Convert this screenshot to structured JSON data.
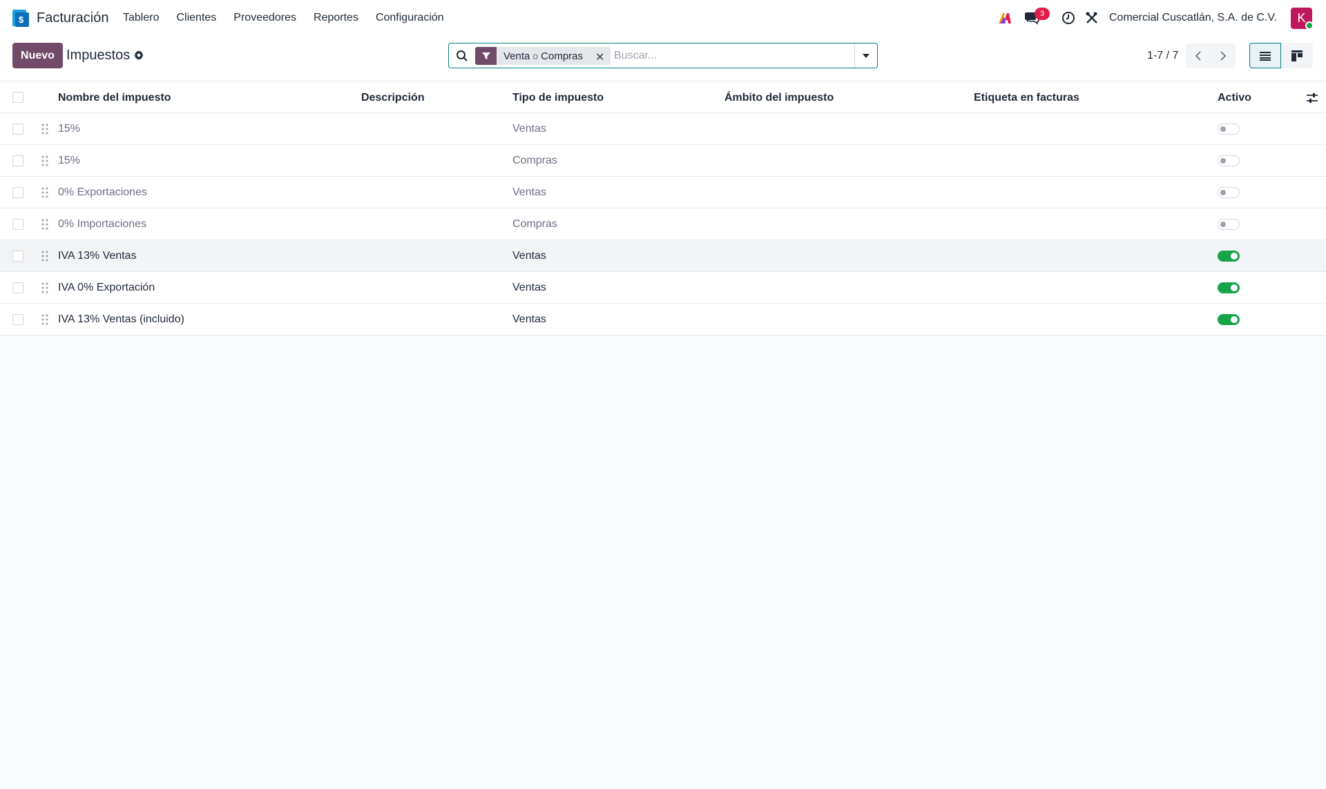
{
  "navbar": {
    "app_name": "Facturación",
    "menu": [
      "Tablero",
      "Clientes",
      "Proveedores",
      "Reportes",
      "Configuración"
    ],
    "messages_count": "3",
    "company": "Comercial Cuscatlán, S.A. de C.V.",
    "avatar_letter": "K"
  },
  "control": {
    "new_label": "Nuevo",
    "title": "Impuestos",
    "facet_a": "Venta",
    "facet_or": "o",
    "facet_b": "Compras",
    "search_placeholder": "Buscar...",
    "pager": "1-7 / 7"
  },
  "table": {
    "columns": [
      "Nombre del impuesto",
      "Descripción",
      "Tipo de impuesto",
      "Ámbito del impuesto",
      "Etiqueta en facturas",
      "Activo"
    ],
    "rows": [
      {
        "name": "15%",
        "descripcion": "",
        "tipo": "Ventas",
        "ambito": "",
        "etiqueta": "",
        "activo": false
      },
      {
        "name": "15%",
        "descripcion": "",
        "tipo": "Compras",
        "ambito": "",
        "etiqueta": "",
        "activo": false
      },
      {
        "name": "0% Exportaciones",
        "descripcion": "",
        "tipo": "Ventas",
        "ambito": "",
        "etiqueta": "",
        "activo": false
      },
      {
        "name": "0% Importaciones",
        "descripcion": "",
        "tipo": "Compras",
        "ambito": "",
        "etiqueta": "",
        "activo": false
      },
      {
        "name": "IVA 13% Ventas",
        "descripcion": "",
        "tipo": "Ventas",
        "ambito": "",
        "etiqueta": "",
        "activo": true
      },
      {
        "name": "IVA 0% Exportación",
        "descripcion": "",
        "tipo": "Ventas",
        "ambito": "",
        "etiqueta": "",
        "activo": true
      },
      {
        "name": "IVA 13% Ventas (incluido)",
        "descripcion": "",
        "tipo": "Ventas",
        "ambito": "",
        "etiqueta": "",
        "activo": true
      }
    ]
  },
  "icons": {
    "app_logo": "invoicing-app-icon",
    "messages": "chat-bubble-icon",
    "activities": "clock-icon",
    "tools": "tools-icon",
    "ai": "ai-logo-icon"
  },
  "colors": {
    "brand": "#714b67",
    "accent": "#017e84",
    "toggle_on": "#16a34a",
    "badge": "#e11d48"
  }
}
